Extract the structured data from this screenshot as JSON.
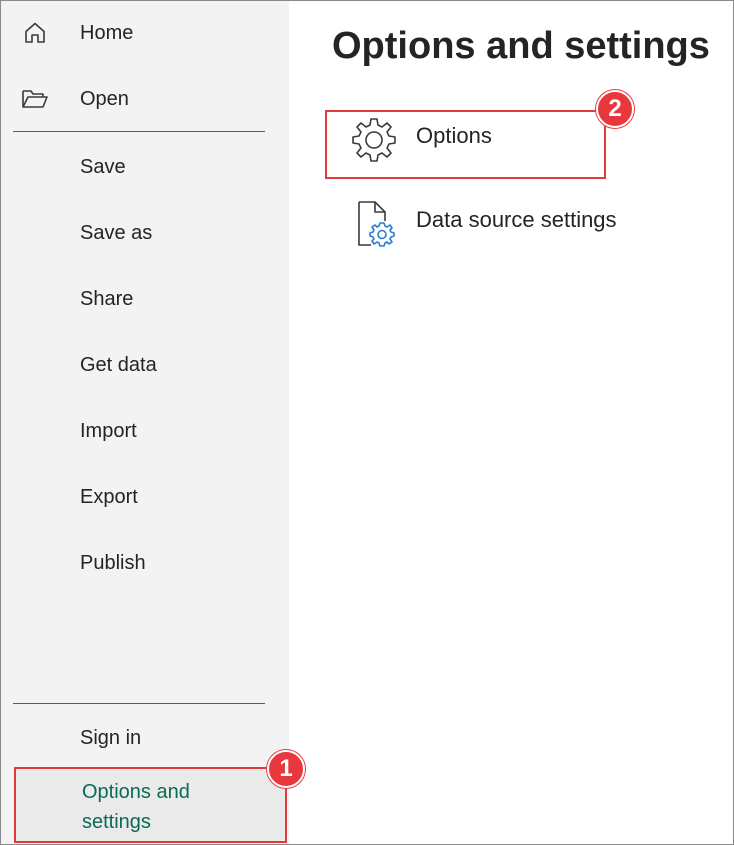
{
  "sidebar": {
    "items": [
      {
        "label": "Home",
        "icon": "home-icon"
      },
      {
        "label": "Open",
        "icon": "folder-open-icon"
      },
      {
        "label": "Save"
      },
      {
        "label": "Save as"
      },
      {
        "label": "Share"
      },
      {
        "label": "Get data"
      },
      {
        "label": "Import"
      },
      {
        "label": "Export"
      },
      {
        "label": "Publish"
      }
    ],
    "footer": {
      "sign_in": "Sign in",
      "options_and_settings": "Options and settings"
    }
  },
  "main": {
    "title": "Options and settings",
    "items": [
      {
        "label": "Options",
        "icon": "gear-icon"
      },
      {
        "label": "Data source settings",
        "icon": "document-gear-icon"
      }
    ]
  },
  "annotations": {
    "step1": "1",
    "step2": "2",
    "highlight_color": "#e0393e"
  },
  "colors": {
    "accent_selected": "#0b6a53",
    "sidebar_bg": "#f3f3f3",
    "icon_blue": "#2b7cd3"
  }
}
